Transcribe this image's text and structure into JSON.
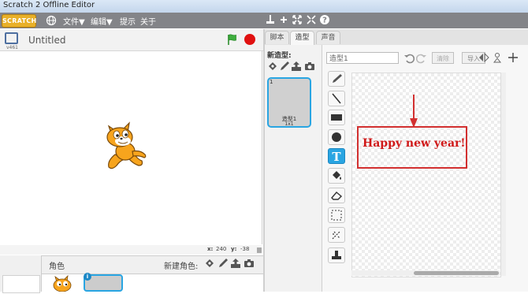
{
  "window": {
    "title": "Scratch 2 Offline Editor"
  },
  "menubar": {
    "logo": "SCRATCH",
    "items": [
      "文件▼",
      "编辑▼",
      "提示",
      "关于"
    ]
  },
  "stage_header": {
    "version": "v461",
    "project_title": "Untitled"
  },
  "coords": {
    "x_label": "x:",
    "x_value": "240",
    "y_label": "y:",
    "y_value": "-38"
  },
  "sprites": {
    "label": "角色",
    "new_sprite": "新建角色:",
    "selected_index": "i"
  },
  "tabs": [
    {
      "label": "脚本",
      "active": false
    },
    {
      "label": "造型",
      "active": true
    },
    {
      "label": "声音",
      "active": false
    }
  ],
  "costumes": {
    "new_label": "新造型:",
    "items": [
      {
        "index": "1",
        "name": "造型1",
        "size": "1x1"
      }
    ]
  },
  "editor": {
    "costume_name_value": "造型1",
    "clear": "清除",
    "import": "导入",
    "tools": [
      "brush",
      "line",
      "rectangle",
      "ellipse",
      "text",
      "fill",
      "eraser",
      "select",
      "duplicate",
      "stamp"
    ],
    "active_tool": "text"
  },
  "annotation": {
    "text": "Happy new year!",
    "color": "#d01818"
  },
  "colors": {
    "accent": "#29a5e2",
    "menubar": "#838488",
    "stop": "#e01010",
    "flag": "#2f8f2f"
  }
}
